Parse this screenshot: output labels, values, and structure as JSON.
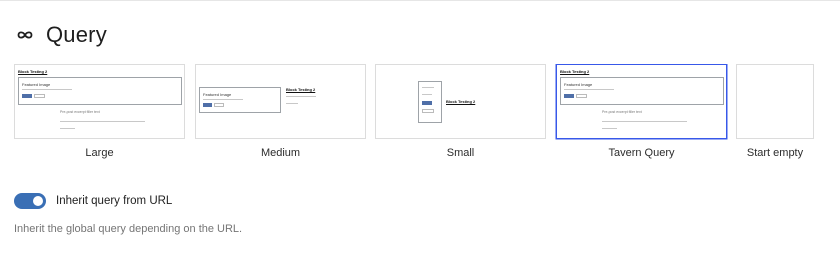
{
  "header": {
    "title": "Query",
    "icon": "loop-icon"
  },
  "patterns": [
    {
      "label": "Large",
      "selected": false,
      "preview": {
        "title": "Block Testing 2",
        "heading": "Featured Image",
        "footer": "Pre-post excerpt filler text"
      }
    },
    {
      "label": "Medium",
      "selected": false,
      "preview": {
        "title": "Block Testing 2",
        "heading": "Featured Image"
      }
    },
    {
      "label": "Small",
      "selected": false,
      "preview": {
        "title": "Block Testing 2"
      }
    },
    {
      "label": "Tavern Query",
      "selected": true,
      "preview": {
        "title": "Block Testing 2",
        "heading": "Featured Image",
        "footer": "Pre-post excerpt filler text"
      }
    },
    {
      "label": "Start empty",
      "selected": false
    }
  ],
  "inherit": {
    "label": "Inherit query from URL",
    "checked": true,
    "help": "Inherit the global query depending on the URL."
  },
  "colors": {
    "accent": "#3a6fb5",
    "selected_border": "#3858e9",
    "help_text": "#757575"
  }
}
